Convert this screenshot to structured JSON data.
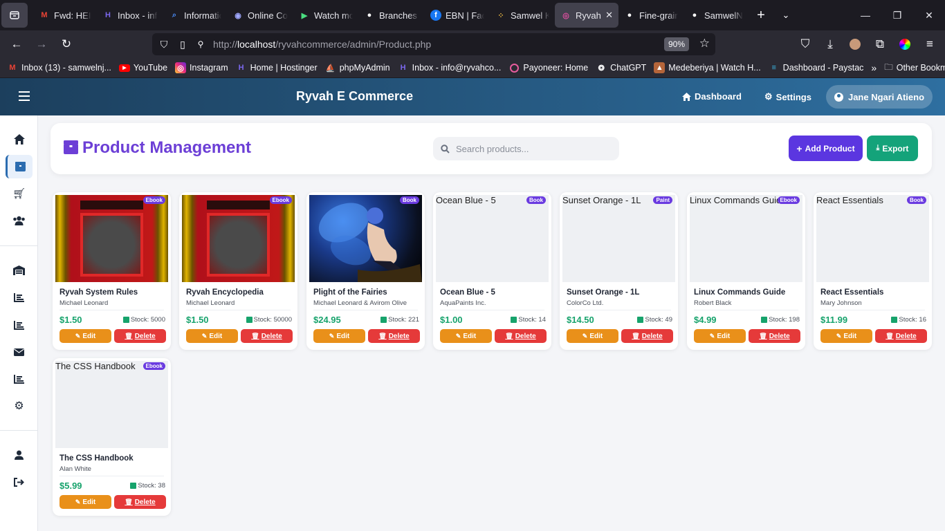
{
  "browser": {
    "tabs": [
      {
        "label": "Fwd: HEIC",
        "icon": "gmail-icon"
      },
      {
        "label": "Inbox - inf",
        "icon": "hostinger-icon"
      },
      {
        "label": "Informatic",
        "icon": "search-console-icon"
      },
      {
        "label": "Online Co",
        "icon": "chat-icon"
      },
      {
        "label": "Watch mo",
        "icon": "play-icon"
      },
      {
        "label": "Branches",
        "icon": "github-icon"
      },
      {
        "label": "EBN | Face",
        "icon": "facebook-icon"
      },
      {
        "label": "Samwel K",
        "icon": "dots-icon"
      },
      {
        "label": "Ryvah",
        "icon": "ryvah-icon"
      },
      {
        "label": "Fine-grain",
        "icon": "github-icon"
      },
      {
        "label": "SamwelNj",
        "icon": "github-icon"
      }
    ],
    "url_prefix": "http://",
    "url_host": "localhost",
    "url_path": "/ryvahcommerce/admin/Product.php",
    "zoom": "90%",
    "bookmarks": [
      "Inbox (13) - samwelnj...",
      "YouTube",
      "Instagram",
      "Home | Hostinger",
      "phpMyAdmin",
      "Inbox - info@ryvahco...",
      "Payoneer: Home",
      "ChatGPT",
      "Medeberiya | Watch H...",
      "Dashboard - Paystac"
    ],
    "other_bookmarks": "Other Bookmarks"
  },
  "topbar": {
    "brand": "Ryvah E Commerce",
    "dashboard": "Dashboard",
    "settings": "Settings",
    "user": "Jane Ngari Atieno"
  },
  "header": {
    "title": "Product Management",
    "search_placeholder": "Search products...",
    "add_label": "Add Product",
    "export_label": "Export"
  },
  "products": [
    {
      "name": "Ryvah System Rules",
      "author": "Michael Leonard",
      "price": "$1.50",
      "stock": "Stock: 5000",
      "badge": "Ebook",
      "alt": ""
    },
    {
      "name": "Ryvah Encyclopedia",
      "author": "Michael Leonard",
      "price": "$1.50",
      "stock": "Stock: 50000",
      "badge": "Ebook",
      "alt": ""
    },
    {
      "name": "Plight of the Fairies",
      "author": "Michael Leonard & Avirom Olive",
      "price": "$24.95",
      "stock": "Stock: 221",
      "badge": "Book",
      "alt": ""
    },
    {
      "name": "Ocean Blue - 5",
      "author": "AquaPaints Inc.",
      "price": "$1.00",
      "stock": "Stock: 14",
      "badge": "Book",
      "alt": "Ocean Blue - 5"
    },
    {
      "name": "Sunset Orange - 1L",
      "author": "ColorCo Ltd.",
      "price": "$14.50",
      "stock": "Stock: 49",
      "badge": "Paint",
      "alt": "Sunset Orange - 1L"
    },
    {
      "name": "Linux Commands Guide",
      "author": "Robert Black",
      "price": "$4.99",
      "stock": "Stock: 198",
      "badge": "Ebook",
      "alt": "Linux Commands Guide"
    },
    {
      "name": "React Essentials",
      "author": "Mary Johnson",
      "price": "$11.99",
      "stock": "Stock: 16",
      "badge": "Book",
      "alt": "React Essentials"
    },
    {
      "name": "The CSS Handbook",
      "author": "Alan White",
      "price": "$5.99",
      "stock": "Stock: 38",
      "badge": "Ebook",
      "alt": "The CSS Handbook"
    }
  ],
  "actions": {
    "edit": "Edit",
    "delete": "Delete"
  }
}
